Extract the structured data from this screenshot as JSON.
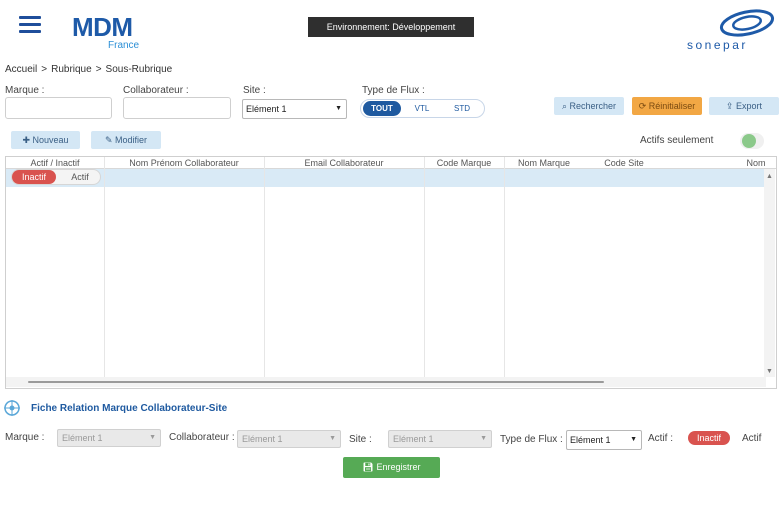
{
  "header": {
    "app_name": "MDM",
    "app_subtitle": "France",
    "environment": "Environnement: Développement",
    "brand": "sonepar"
  },
  "breadcrumb": [
    "Accueil",
    ">",
    "Rubrique",
    ">",
    "Sous-Rubrique"
  ],
  "filters": {
    "marque_label": "Marque :",
    "collaborateur_label": "Collaborateur :",
    "site_label": "Site :",
    "site_value": "Elément 1",
    "flux_label": "Type de Flux :",
    "flux_options": [
      "TOUT",
      "VTL",
      "STD"
    ],
    "flux_selected": "TOUT"
  },
  "actions": {
    "rechercher": "Rechercher",
    "reinitialiser": "Réinitialiser",
    "export": "Export",
    "nouveau": "Nouveau",
    "modifier": "Modifier",
    "actifs_seulement": "Actifs seulement"
  },
  "grid": {
    "columns": [
      "Actif / Inactif",
      "Nom Prénom Collaborateur",
      "Email Collaborateur",
      "Code Marque",
      "Nom Marque",
      "Code Site",
      "Nom"
    ],
    "row_toggle": {
      "inactif": "Inactif",
      "actif": "Actif"
    }
  },
  "form": {
    "title": "Fiche Relation Marque Collaborateur-Site",
    "marque_label": "Marque :",
    "marque_value": "Elément 1",
    "collaborateur_label": "Collaborateur :",
    "collaborateur_value": "Elément 1",
    "site_label": "Site :",
    "site_value": "Elément 1",
    "flux_label": "Type de Flux :",
    "flux_value": "Elément 1",
    "actif_label": "Actif :",
    "inactif": "Inactif",
    "actif": "Actif",
    "save": "Enregistrer"
  },
  "colors": {
    "brand_blue": "#1e5aa8",
    "danger": "#d9534f",
    "success": "#56aa55",
    "warning": "#f2a744"
  }
}
